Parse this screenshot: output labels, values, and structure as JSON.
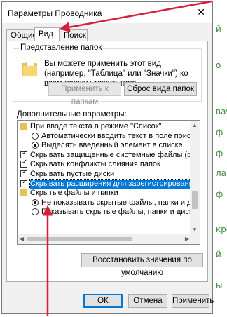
{
  "background_right_text": [
    "й",
    "о",
    "вача",
    "ф",
    "ф",
    "ла",
    "ф",
    "кро",
    "й",
    "ы"
  ],
  "dialog": {
    "title": "Параметры Проводника",
    "tabs": [
      {
        "label": "Общие"
      },
      {
        "label": "Вид"
      },
      {
        "label": "Поиск"
      }
    ]
  },
  "folder_views": {
    "group_label": "Представление папок",
    "description": "Вы можете применить этот вид (например, \"Таблица\" или \"Значки\") ко всем папкам такого типа.",
    "apply_button": "Применить к папкам",
    "reset_button": "Сброс вида папок"
  },
  "advanced": {
    "label": "Дополнительные параметры:",
    "items": [
      {
        "type": "folder",
        "text": "При вводе текста в режиме \"Список\""
      },
      {
        "type": "radio",
        "checked": false,
        "text": "Автоматически вводить текст в поле поиска"
      },
      {
        "type": "radio",
        "checked": true,
        "text": "Выделять введенный элемент в списке"
      },
      {
        "type": "checkbox",
        "checked": true,
        "text": "Скрывать защищенные системные файлы (рекомен..."
      },
      {
        "type": "checkbox",
        "checked": true,
        "text": "Скрывать конфликты слияния папок"
      },
      {
        "type": "checkbox",
        "checked": true,
        "text": "Скрывать пустые диски"
      },
      {
        "type": "checkbox",
        "checked": true,
        "text": "Скрывать расширения для зарегистрированных типо",
        "selected": true
      },
      {
        "type": "folder",
        "text": "Скрытые файлы и папки"
      },
      {
        "type": "radio",
        "checked": true,
        "text": "Не показывать скрытые файлы, папки и диски"
      },
      {
        "type": "radio",
        "checked": false,
        "text": "Показывать скрытые файлы, папки и диски"
      }
    ],
    "restore_button": "Восстановить значения по умолчанию"
  },
  "footer": {
    "ok": "ОК",
    "cancel": "Отмена",
    "apply": "Применить"
  },
  "colors": {
    "selection": "#0078d7",
    "annotation_arrow": "#d6203a",
    "folder": "#e8c158"
  }
}
